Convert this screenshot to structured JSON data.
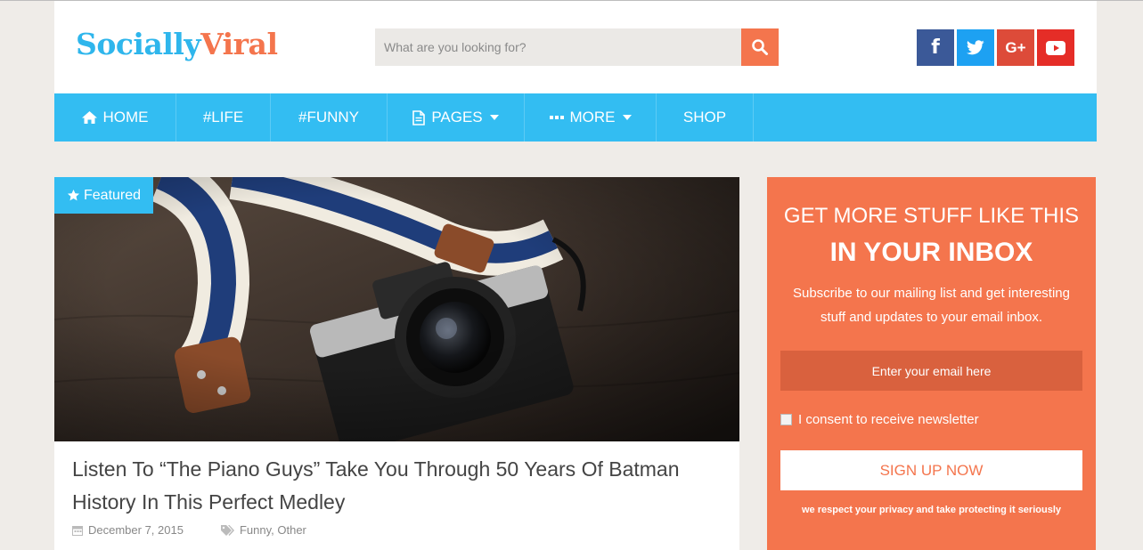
{
  "header": {
    "logo_part1": "Socially",
    "logo_part2": "Viral",
    "search_placeholder": "What are you looking for?",
    "social": [
      {
        "icon": "facebook-icon",
        "glyph": "f",
        "color": "#3b5998"
      },
      {
        "icon": "twitter-icon",
        "color": "#1da1f2"
      },
      {
        "icon": "google-plus-icon",
        "glyph": "G+",
        "color": "#dd4b39"
      },
      {
        "icon": "youtube-icon",
        "color": "#e52d27"
      }
    ]
  },
  "nav": {
    "items": [
      {
        "label": "HOME",
        "icon": "home-icon"
      },
      {
        "label": "#LIFE"
      },
      {
        "label": "#FUNNY"
      },
      {
        "label": "PAGES",
        "icon": "page-icon",
        "dropdown": true
      },
      {
        "label": "MORE",
        "icon": "ellipsis-icon",
        "dropdown": true
      },
      {
        "label": "SHOP"
      }
    ]
  },
  "article": {
    "badge": "Featured",
    "title": "Listen To “The Piano Guys” Take You Through 50 Years Of Batman History In This Perfect Medley",
    "date": "December 7, 2015",
    "categories": [
      "Funny",
      "Other"
    ],
    "category_sep": ", "
  },
  "newsletter": {
    "heading_line1": "GET MORE STUFF LIKE THIS",
    "heading_line2": "IN YOUR INBOX",
    "description": "Subscribe to our mailing list and get interesting stuff and updates to your email inbox.",
    "email_placeholder": "Enter your email here",
    "consent_label": "I consent to receive newsletter",
    "button_label": "SIGN UP NOW",
    "privacy_note": "we respect your privacy and take protecting it seriously"
  },
  "colors": {
    "accent_blue": "#33bdf2",
    "accent_orange": "#f4754d",
    "background": "#efece8"
  }
}
